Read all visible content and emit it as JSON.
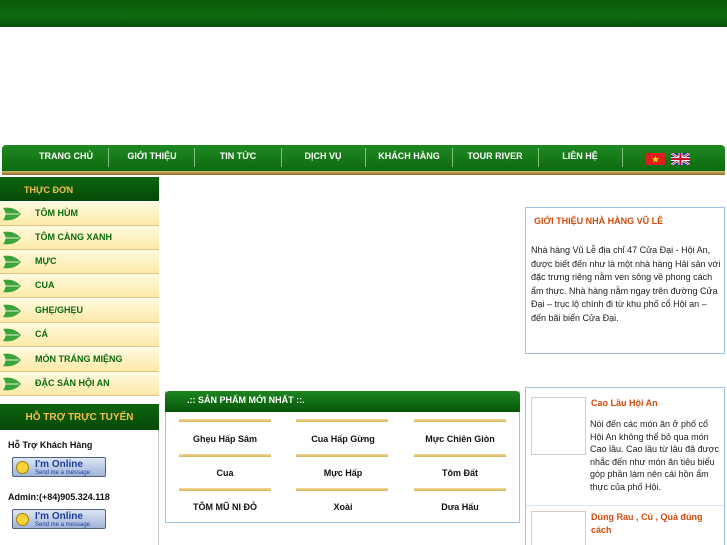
{
  "nav": {
    "items": [
      "TRANG CHỦ",
      "GIỚI THIỆU",
      "TIN TỨC",
      "DỊCH VỤ",
      "KHÁCH HÀNG",
      "TOUR RIVER",
      "LIÊN HỆ"
    ]
  },
  "menu": {
    "title": "THỰC ĐƠN",
    "items": [
      "TÔM HÙM",
      "TÔM CÀNG XANH",
      "MỰC",
      "CUA",
      "GHẸ/GHẸU",
      "CÁ",
      "MÓN TRÁNG MIỆNG",
      "ĐẶC SẢN HỘI AN"
    ]
  },
  "support": {
    "title": "HỖ TRỢ TRỰC TUYẾN",
    "customer_label": "Hỗ Trợ Khách Hàng",
    "admin_label": "Admin:(+84)905.324.118",
    "online_title": "I'm Online",
    "online_sub": "Send me a message"
  },
  "intro": {
    "title": "GIỚI THIỆU NHÀ HÀNG VŨ LÊ",
    "text": "Nhà hàng Vũ Lễ địa chỉ 47 Cửa Đại - Hội An, được biết đến như là một nhà hàng Hải sản với đặc trưng riêng nằm ven sông về phong cách ẩm thực. Nhà hàng nằm ngay trên đường Cửa Đại – trục lộ chính đi từ khu phố cổ Hội an – đến bãi biển Cửa Đại."
  },
  "news": [
    {
      "title": "Cao Lầu Hội An",
      "text": "Nói đến các món ăn ở phố cổ Hội An không thể bỏ qua món Cao lầu. Cao lầu từ lâu đã được nhắc đến như món ăn tiêu biểu góp phần làm nên cái hồn ẩm thực của phố Hội."
    },
    {
      "title": "Dùng Rau , Củ , Quả đúng cách",
      "text": ""
    }
  ],
  "products": {
    "title": ".:: SẢN PHẨM MỚI NHẤT ::.",
    "items": [
      "Ghẹu Hấp Sâm",
      "Cua Hấp Gừng",
      "Mực Chiên Giòn",
      "Cua",
      "Mực Hấp",
      "Tôm Đất",
      "TÔM MŨ NI ĐỎ",
      "Xoài",
      "Dưa Hấu"
    ]
  },
  "colors": {
    "brand_green": "#0b6b0b",
    "accent_orange": "#d14b0c",
    "menu_gold": "#f5c04a"
  },
  "icons": {
    "flag_vn": "vietnam-flag-icon",
    "flag_uk": "uk-flag-icon",
    "menu_leaf": "leaf-icon",
    "online": "smiley-icon"
  }
}
